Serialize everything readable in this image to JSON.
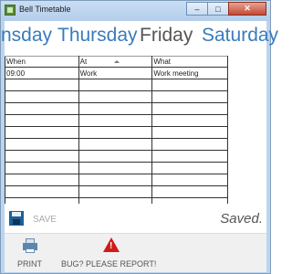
{
  "window": {
    "title": "Bell Timetable",
    "minimize": "–",
    "maximize": "□",
    "close": "✕"
  },
  "days": {
    "items": [
      {
        "label": "nsday"
      },
      {
        "label": "Thursday"
      },
      {
        "label": "Friday"
      },
      {
        "label": "Saturday"
      }
    ],
    "active": "Friday"
  },
  "timetable": {
    "columns": [
      "When",
      "At",
      "What"
    ],
    "rows": [
      [
        "09:00",
        "Work",
        "Work meeting"
      ],
      [
        "",
        "",
        ""
      ],
      [
        "",
        "",
        ""
      ],
      [
        "",
        "",
        ""
      ],
      [
        "",
        "",
        ""
      ],
      [
        "",
        "",
        ""
      ],
      [
        "",
        "",
        ""
      ],
      [
        "",
        "",
        ""
      ],
      [
        "",
        "",
        ""
      ],
      [
        "",
        "",
        ""
      ],
      [
        "",
        "",
        ""
      ],
      [
        "",
        "",
        ""
      ]
    ]
  },
  "toolbar": {
    "save_label": "SAVE",
    "status": "Saved."
  },
  "appbar": {
    "print_label": "PRINT",
    "bug_label": "BUG? PLEASE REPORT!"
  },
  "colors": {
    "accent": "#3a7bbd",
    "bug": "#d21a1a",
    "save_icon": "#1f5f96"
  }
}
